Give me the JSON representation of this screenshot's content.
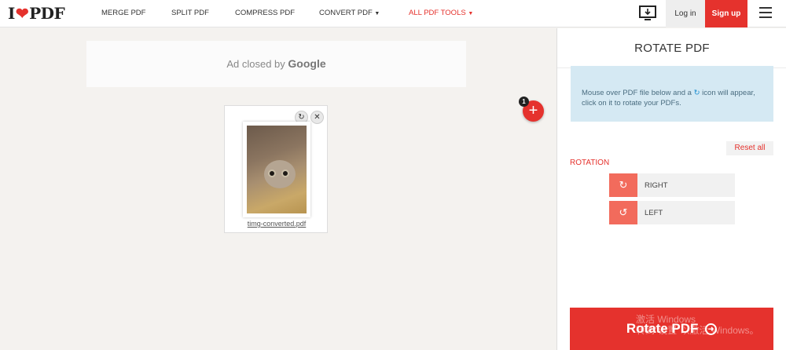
{
  "logo": {
    "prefix": "I",
    "heart": "❤",
    "suffix": "PDF"
  },
  "nav": {
    "merge": "MERGE PDF",
    "split": "SPLIT PDF",
    "compress": "COMPRESS PDF",
    "convert": "CONVERT PDF",
    "all_tools": "ALL PDF TOOLS",
    "login": "Log in",
    "signup": "Sign up"
  },
  "ad": {
    "text": "Ad closed by ",
    "brand": "Google"
  },
  "file": {
    "name": "timg-converted.pdf",
    "count": "1"
  },
  "sidebar": {
    "title": "ROTATE PDF",
    "info_before": "Mouse over PDF file below and a ",
    "info_after": " icon will appear, click on it to rotate your PDFs.",
    "reset": "Reset all",
    "rotation_label": "ROTATION",
    "options": [
      {
        "label": "RIGHT",
        "icon": "rotate-right-icon"
      },
      {
        "label": "LEFT",
        "icon": "rotate-left-icon"
      }
    ],
    "action": "Rotate PDF"
  },
  "watermark": {
    "line1": "激活 Windows",
    "line2": "转到\"设置\"以激活 Windows。"
  },
  "colors": {
    "brand": "#e5322d",
    "info_bg": "#d5e9f3",
    "rotate_icon_bg": "#f26b5c"
  }
}
